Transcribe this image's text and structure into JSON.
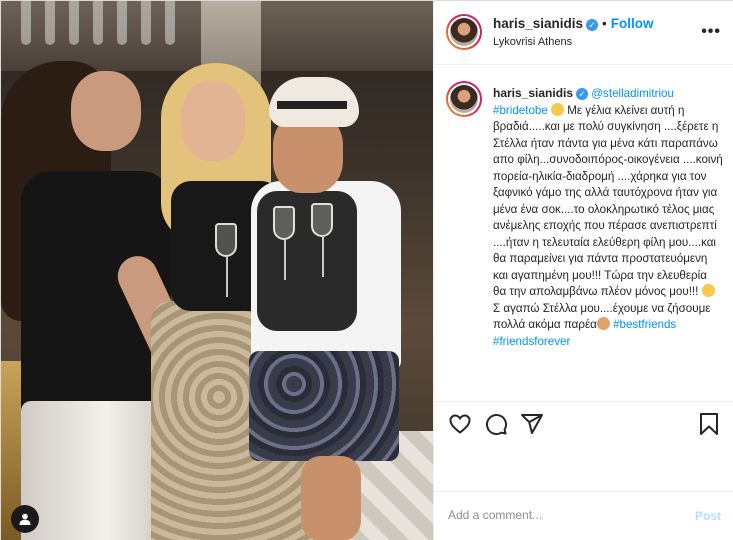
{
  "header": {
    "username": "haris_sianidis",
    "verified_glyph": "✓",
    "separator": "•",
    "follow_label": "Follow",
    "location": "Lykovrisi Athens",
    "more_icon": "more-options-icon",
    "more_label": "•••"
  },
  "caption": {
    "username": "haris_sianidis",
    "mention": "@stelladimitriou",
    "hashtag": "#bridetobe",
    "text": " Με γέλια κλείνει αυτή η βραδιά.....και με πολύ συγκίνηση ....ξέρετε η Στέλλα ήταν πάντα για μένα κάτι παραπάνω απο φίλη...συνοδοιπόρος-οικογένεια ....κοινή πορεία-ηλικία-διαδρομή ....χάρηκα για τον ξαφνικό γάμο της αλλά ταυτόχρονα ήταν για μένα ένα σοκ....το ολοκληρωτικό τέλος μιας ανέμελης εποχής που πέρασε ανεπιστρεπτί ....ήταν η τελευταία ελεύθερη φίλη μου....και θα παραμείνει για πάντα προστατευόμενη και αγαπημένη μου!!! Τώρα την ελευθερία θα την απολαμβάνω πλέον μόνος μου!!! ",
    "text_2": " Σ αγαπώ Στέλλα μου....έχουμε να ζήσουμε πολλά ακόμα παρέα",
    "trailing_tags": "#bestfriends #friendsforever"
  },
  "actions": {
    "like_icon": "heart-icon",
    "comment_icon": "comment-icon",
    "share_icon": "share-icon",
    "save_icon": "bookmark-icon"
  },
  "comment": {
    "placeholder": "Add a comment...",
    "post_label": "Post"
  },
  "colors": {
    "accent": "#0095f6",
    "post_disabled": "#b2dffc",
    "border": "#efefef"
  }
}
